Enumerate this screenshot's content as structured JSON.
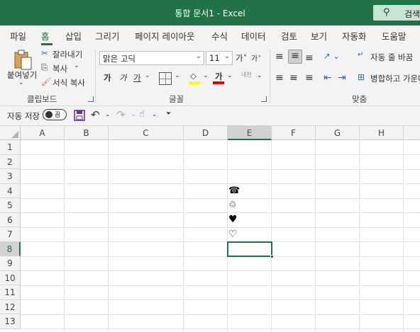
{
  "window": {
    "title": "통합 문서1  -  Excel",
    "search_label": "검색("
  },
  "menu": {
    "tabs": [
      "파일",
      "홈",
      "삽입",
      "그리기",
      "페이지 레이아웃",
      "수식",
      "데이터",
      "검토",
      "보기",
      "자동화",
      "도움말"
    ]
  },
  "ribbon": {
    "clipboard": {
      "paste_label": "붙여넣기",
      "cut_label": "잘라내기",
      "copy_label": "복사",
      "format_painter_label": "서식 복사",
      "group_label": "클립보드"
    },
    "font": {
      "font_name": "맑은 고딕",
      "font_size": "11",
      "bold": "가",
      "italic": "가",
      "underline": "가",
      "phonetic": "내천",
      "group_label": "글꼴"
    },
    "alignment": {
      "wrap_text_label": "자동 줄 바꿈",
      "merge_label": "병합하고 가운데",
      "group_label": "맞춤"
    }
  },
  "qat": {
    "autosave_label": "자동 저장",
    "toggle_state": "끔"
  },
  "sheet": {
    "columns": [
      "A",
      "B",
      "C",
      "D",
      "E",
      "F",
      "G",
      "H"
    ],
    "selected_column": "E",
    "rows": [
      "1",
      "2",
      "3",
      "4",
      "5",
      "6",
      "7",
      "8",
      "9",
      "10",
      "11",
      "12",
      "13"
    ],
    "selected_row": "8",
    "active_cell": "E8",
    "cells": {
      "E4": "☎",
      "E5": "♲",
      "E6": "♥",
      "E7": "♡"
    }
  }
}
